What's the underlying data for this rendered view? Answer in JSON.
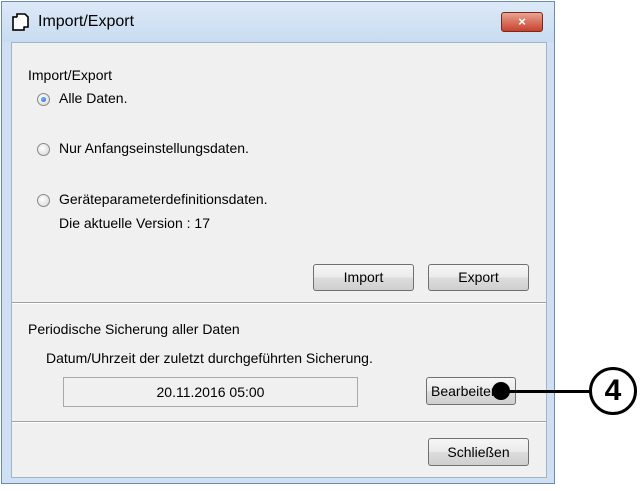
{
  "window": {
    "title": "Import/Export",
    "close_label": "×",
    "icon": "copy-pages-icon"
  },
  "group_import": {
    "label": "Import/Export",
    "options": [
      {
        "label": "Alle Daten.",
        "checked": true
      },
      {
        "label": "Nur Anfangseinstellungsdaten.",
        "checked": false
      },
      {
        "label": "Geräteparameterdefinitionsdaten.",
        "checked": false
      }
    ],
    "version_text": "Die aktuelle Version : 17",
    "import_label": "Import",
    "export_label": "Export"
  },
  "backup": {
    "label": "Periodische Sicherung aller Daten",
    "description": "Datum/Uhrzeit der zuletzt durchgeführten Sicherung.",
    "datetime": "20.11.2016 05:00",
    "edit_label": "Bearbeiten"
  },
  "close_button_label": "Schließen",
  "callout": {
    "number": "4"
  }
}
